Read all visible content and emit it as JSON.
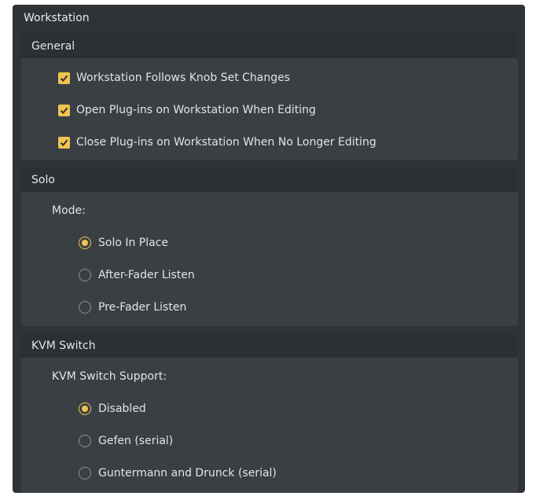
{
  "window": {
    "title": "Workstation"
  },
  "colors": {
    "accent": "#f0c451",
    "panel": "#3a3f44",
    "header": "#2c3034"
  },
  "general": {
    "header": "General",
    "items": [
      {
        "label": "Workstation Follows Knob Set Changes",
        "checked": true
      },
      {
        "label": "Open Plug-ins on Workstation When Editing",
        "checked": true
      },
      {
        "label": "Close Plug-ins on Workstation When No Longer Editing",
        "checked": true
      }
    ]
  },
  "solo": {
    "header": "Solo",
    "mode_label": "Mode:",
    "options": [
      {
        "label": "Solo In Place",
        "selected": true
      },
      {
        "label": "After-Fader Listen",
        "selected": false
      },
      {
        "label": "Pre-Fader Listen",
        "selected": false
      }
    ]
  },
  "kvm": {
    "header": "KVM Switch",
    "support_label": "KVM Switch Support:",
    "options": [
      {
        "label": "Disabled",
        "selected": true
      },
      {
        "label": "Gefen (serial)",
        "selected": false
      },
      {
        "label": "Guntermann and Drunck (serial)",
        "selected": false
      }
    ]
  }
}
